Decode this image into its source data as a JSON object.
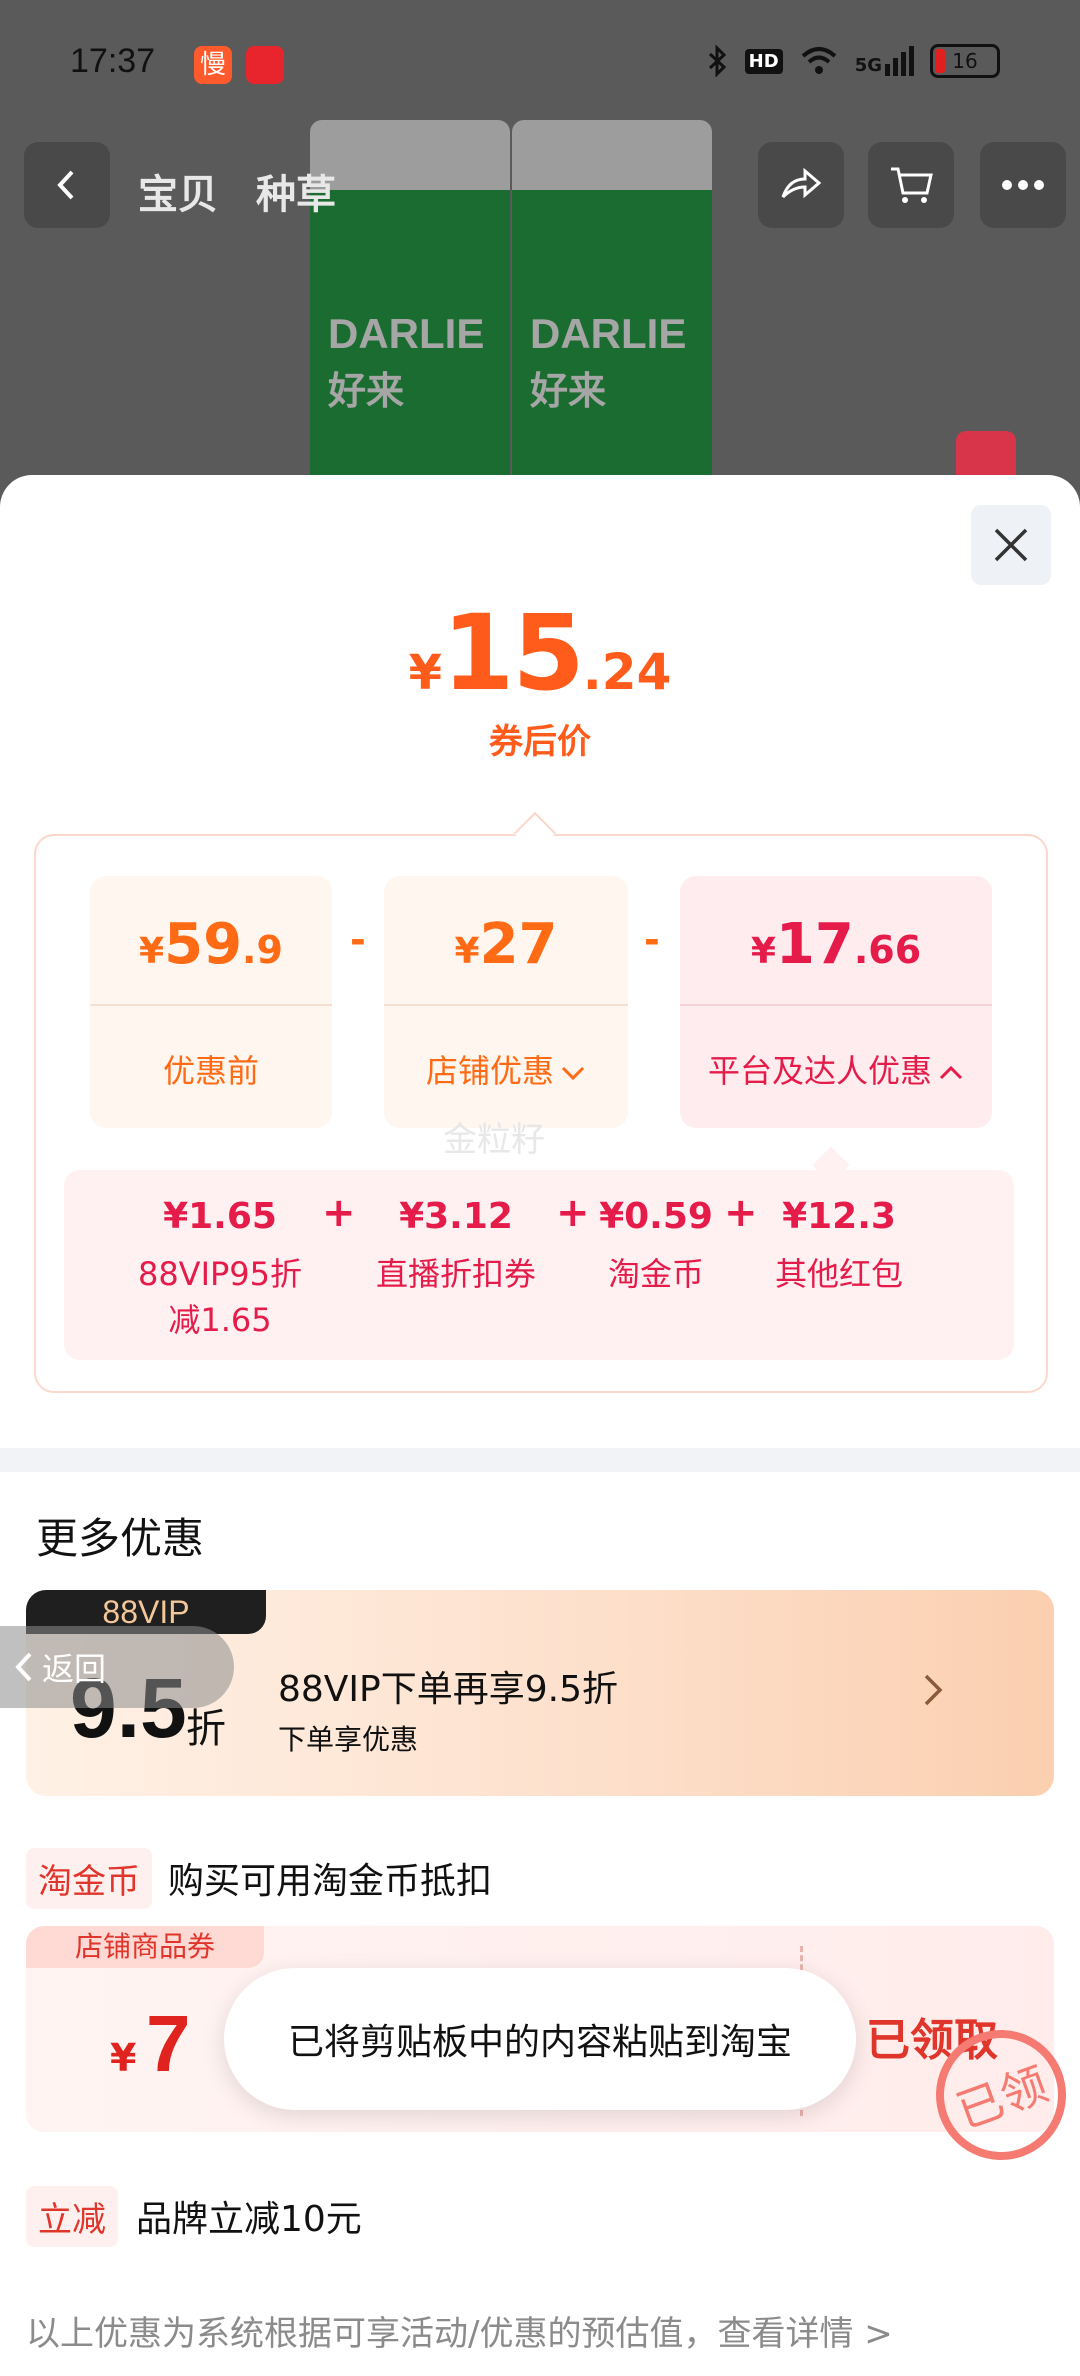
{
  "status_bar": {
    "time": "17:37",
    "app1_glyph": "慢",
    "icons": [
      "bluetooth-icon",
      "hd-icon",
      "wifi-icon",
      "5g-signal-icon"
    ],
    "hd": "HD",
    "net": "5G",
    "battery": "16"
  },
  "nav": {
    "tabs": [
      "宝贝",
      "种草"
    ]
  },
  "product": {
    "brand": "DARLIE",
    "brand_cn": "好来"
  },
  "sheet": {
    "price": {
      "currency": "¥",
      "int": "15",
      "dec": ".24"
    },
    "price_label": "券后价",
    "cards": [
      {
        "currency": "¥",
        "int": "59",
        "dec": ".9",
        "label": "优惠前"
      },
      {
        "currency": "¥",
        "int": "27",
        "dec": "",
        "label": "店铺优惠"
      },
      {
        "currency": "¥",
        "int": "17",
        "dec": ".66",
        "label": "平台及达人优惠"
      }
    ],
    "minus": "-",
    "breakdown": [
      {
        "value": "¥1.65",
        "label1": "88VIP95折",
        "label2": "减1.65"
      },
      {
        "value": "¥3.12",
        "label1": "直播折扣券",
        "label2": ""
      },
      {
        "value": "¥0.59",
        "label1": "淘金币",
        "label2": ""
      },
      {
        "value": "¥12.3",
        "label1": "其他红包",
        "label2": ""
      }
    ],
    "plus": "+",
    "watermark": "金粒籽"
  },
  "more": {
    "title": "更多优惠",
    "vip": {
      "tag": "88VIP",
      "num": "9.5",
      "unit": "折",
      "title": "88VIP下单再享9.5折",
      "subtitle": "下单享优惠"
    },
    "back_label": "返回",
    "coin": {
      "tag": "淘金币",
      "text": "购买可用淘金币抵扣"
    },
    "coupon": {
      "tag": "店铺商品券",
      "currency": "¥",
      "value": "7",
      "claimed": "已领取",
      "stamp": "已领"
    },
    "cut": {
      "tag": "立减",
      "text": "品牌立减10元"
    },
    "footer": "以上优惠为系统根据可享活动/优惠的预估值，查看详情 >"
  },
  "toast": "已将剪贴板中的内容粘贴到淘宝",
  "colors": {
    "accent_orange": "#ff5b1a",
    "accent_red": "#e51c4a",
    "coupon_red": "#e0352a"
  }
}
